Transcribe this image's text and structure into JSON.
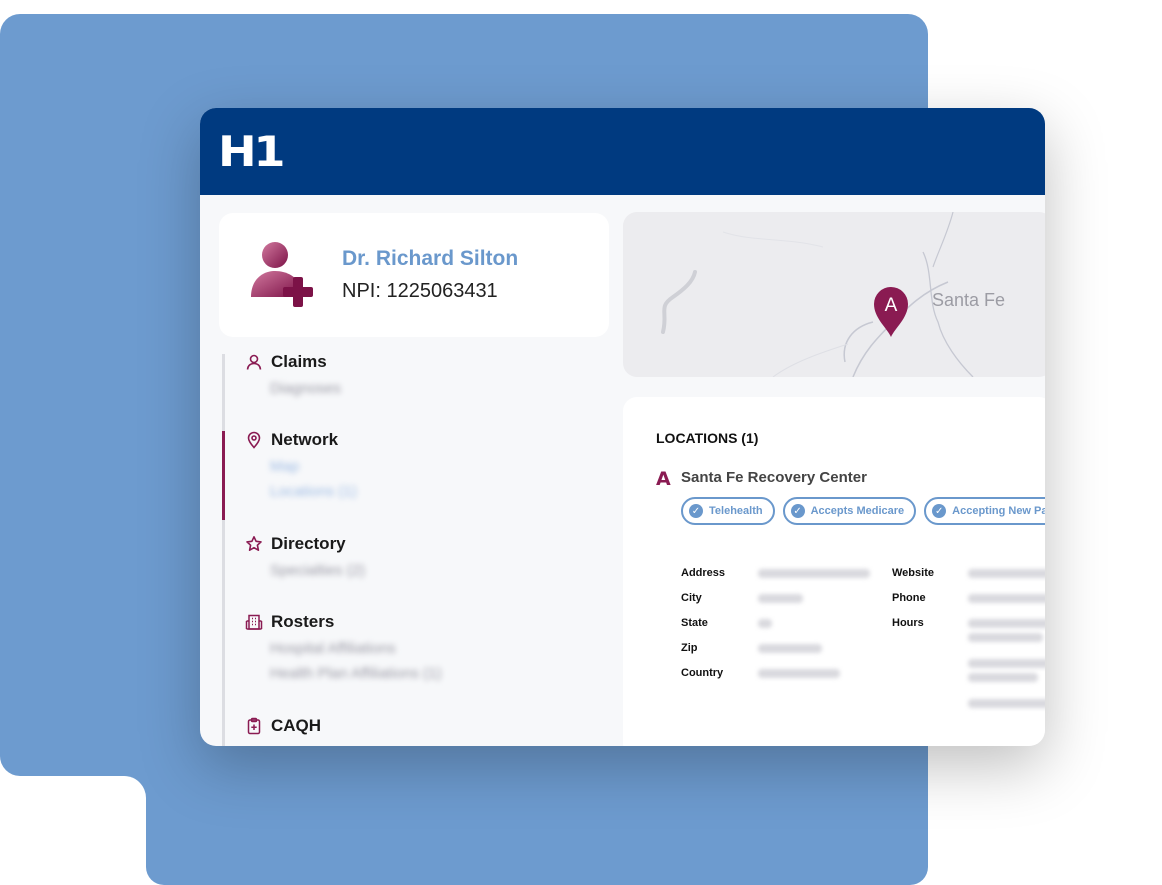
{
  "app": {
    "logo": "H1"
  },
  "profile": {
    "name": "Dr. Richard Silton",
    "npi": "NPI: 1225063431"
  },
  "nav": [
    {
      "title": "Claims",
      "icon": "person-icon",
      "lines": [
        "Diagnoses"
      ]
    },
    {
      "title": "Network",
      "icon": "location-pin-icon",
      "lines": [
        "Map",
        "Locations (1)"
      ],
      "active": true
    },
    {
      "title": "Directory",
      "icon": "star-icon",
      "lines": [
        "Specialties (2)"
      ]
    },
    {
      "title": "Rosters",
      "icon": "building-icon",
      "lines": [
        "Hospital Affiliations",
        "Health Plan Affiliations (1)"
      ]
    },
    {
      "title": "CAQH",
      "icon": "clipboard-plus-icon",
      "lines": [
        ""
      ]
    }
  ],
  "map": {
    "city_label": "Santa Fe",
    "pin_label": "A"
  },
  "locations": {
    "heading": "LOCATIONS (1)",
    "items": [
      {
        "marker": "A",
        "name": "Santa Fe Recovery Center",
        "badges": [
          "Telehealth",
          "Accepts Medicare",
          "Accepting New Patients"
        ],
        "detail_labels_left": [
          "Address",
          "City",
          "State",
          "Zip",
          "Country"
        ],
        "detail_labels_right": [
          "Website",
          "Phone",
          "Hours"
        ]
      }
    ]
  },
  "colors": {
    "accent": "#8a1b52",
    "primary": "#003a80",
    "link": "#6a98cc",
    "background_shape": "#6d9bcf"
  }
}
